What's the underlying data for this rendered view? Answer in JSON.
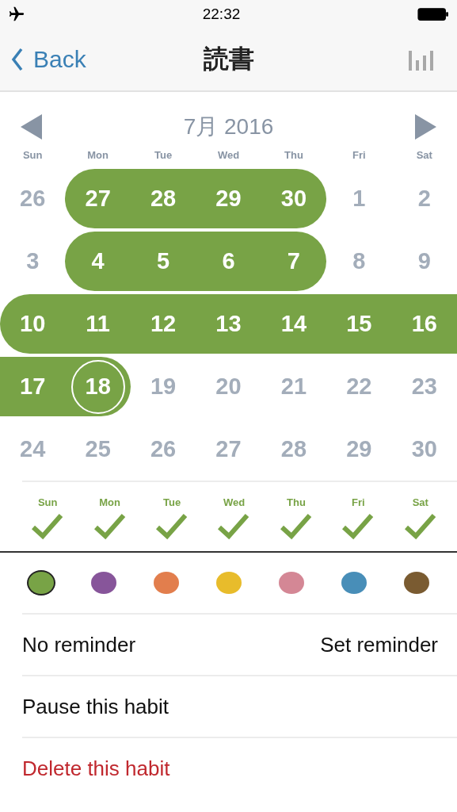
{
  "status_bar": {
    "time": "22:32"
  },
  "nav": {
    "back": "Back",
    "title": "読書"
  },
  "month": {
    "title": "7月 2016"
  },
  "weekdays": [
    "Sun",
    "Mon",
    "Tue",
    "Wed",
    "Thu",
    "Fri",
    "Sat"
  ],
  "weeks": [
    [
      {
        "day": "26",
        "done": false,
        "today": false
      },
      {
        "day": "27",
        "done": true,
        "today": false
      },
      {
        "day": "28",
        "done": true,
        "today": false
      },
      {
        "day": "29",
        "done": true,
        "today": false
      },
      {
        "day": "30",
        "done": true,
        "today": false
      },
      {
        "day": "1",
        "done": false,
        "today": false
      },
      {
        "day": "2",
        "done": false,
        "today": false
      }
    ],
    [
      {
        "day": "3",
        "done": false,
        "today": false
      },
      {
        "day": "4",
        "done": true,
        "today": false
      },
      {
        "day": "5",
        "done": true,
        "today": false
      },
      {
        "day": "6",
        "done": true,
        "today": false
      },
      {
        "day": "7",
        "done": true,
        "today": false
      },
      {
        "day": "8",
        "done": false,
        "today": false
      },
      {
        "day": "9",
        "done": false,
        "today": false
      }
    ],
    [
      {
        "day": "10",
        "done": true,
        "today": false
      },
      {
        "day": "11",
        "done": true,
        "today": false
      },
      {
        "day": "12",
        "done": true,
        "today": false
      },
      {
        "day": "13",
        "done": true,
        "today": false
      },
      {
        "day": "14",
        "done": true,
        "today": false
      },
      {
        "day": "15",
        "done": true,
        "today": false
      },
      {
        "day": "16",
        "done": true,
        "today": false
      }
    ],
    [
      {
        "day": "17",
        "done": true,
        "today": false
      },
      {
        "day": "18",
        "done": true,
        "today": true
      },
      {
        "day": "19",
        "done": false,
        "today": false
      },
      {
        "day": "20",
        "done": false,
        "today": false
      },
      {
        "day": "21",
        "done": false,
        "today": false
      },
      {
        "day": "22",
        "done": false,
        "today": false
      },
      {
        "day": "23",
        "done": false,
        "today": false
      }
    ],
    [
      {
        "day": "24",
        "done": false,
        "today": false
      },
      {
        "day": "25",
        "done": false,
        "today": false
      },
      {
        "day": "26",
        "done": false,
        "today": false
      },
      {
        "day": "27",
        "done": false,
        "today": false
      },
      {
        "day": "28",
        "done": false,
        "today": false
      },
      {
        "day": "29",
        "done": false,
        "today": false
      },
      {
        "day": "30",
        "done": false,
        "today": false
      }
    ]
  ],
  "schedule": [
    {
      "label": "Sun",
      "checked": true
    },
    {
      "label": "Mon",
      "checked": true
    },
    {
      "label": "Tue",
      "checked": true
    },
    {
      "label": "Wed",
      "checked": true
    },
    {
      "label": "Thu",
      "checked": true
    },
    {
      "label": "Fri",
      "checked": true
    },
    {
      "label": "Sat",
      "checked": true
    }
  ],
  "colors": [
    {
      "color": "#78a346",
      "selected": true
    },
    {
      "color": "#87559a",
      "selected": false
    },
    {
      "color": "#e27e4d",
      "selected": false
    },
    {
      "color": "#e8bc2b",
      "selected": false
    },
    {
      "color": "#d48795",
      "selected": false
    },
    {
      "color": "#488eb8",
      "selected": false
    },
    {
      "color": "#7a5b31",
      "selected": false
    }
  ],
  "reminder": {
    "status": "No reminder",
    "action": "Set reminder"
  },
  "actions": [
    {
      "label": "Pause this habit",
      "kind": "normal"
    },
    {
      "label": "Delete this habit",
      "kind": "danger"
    }
  ]
}
